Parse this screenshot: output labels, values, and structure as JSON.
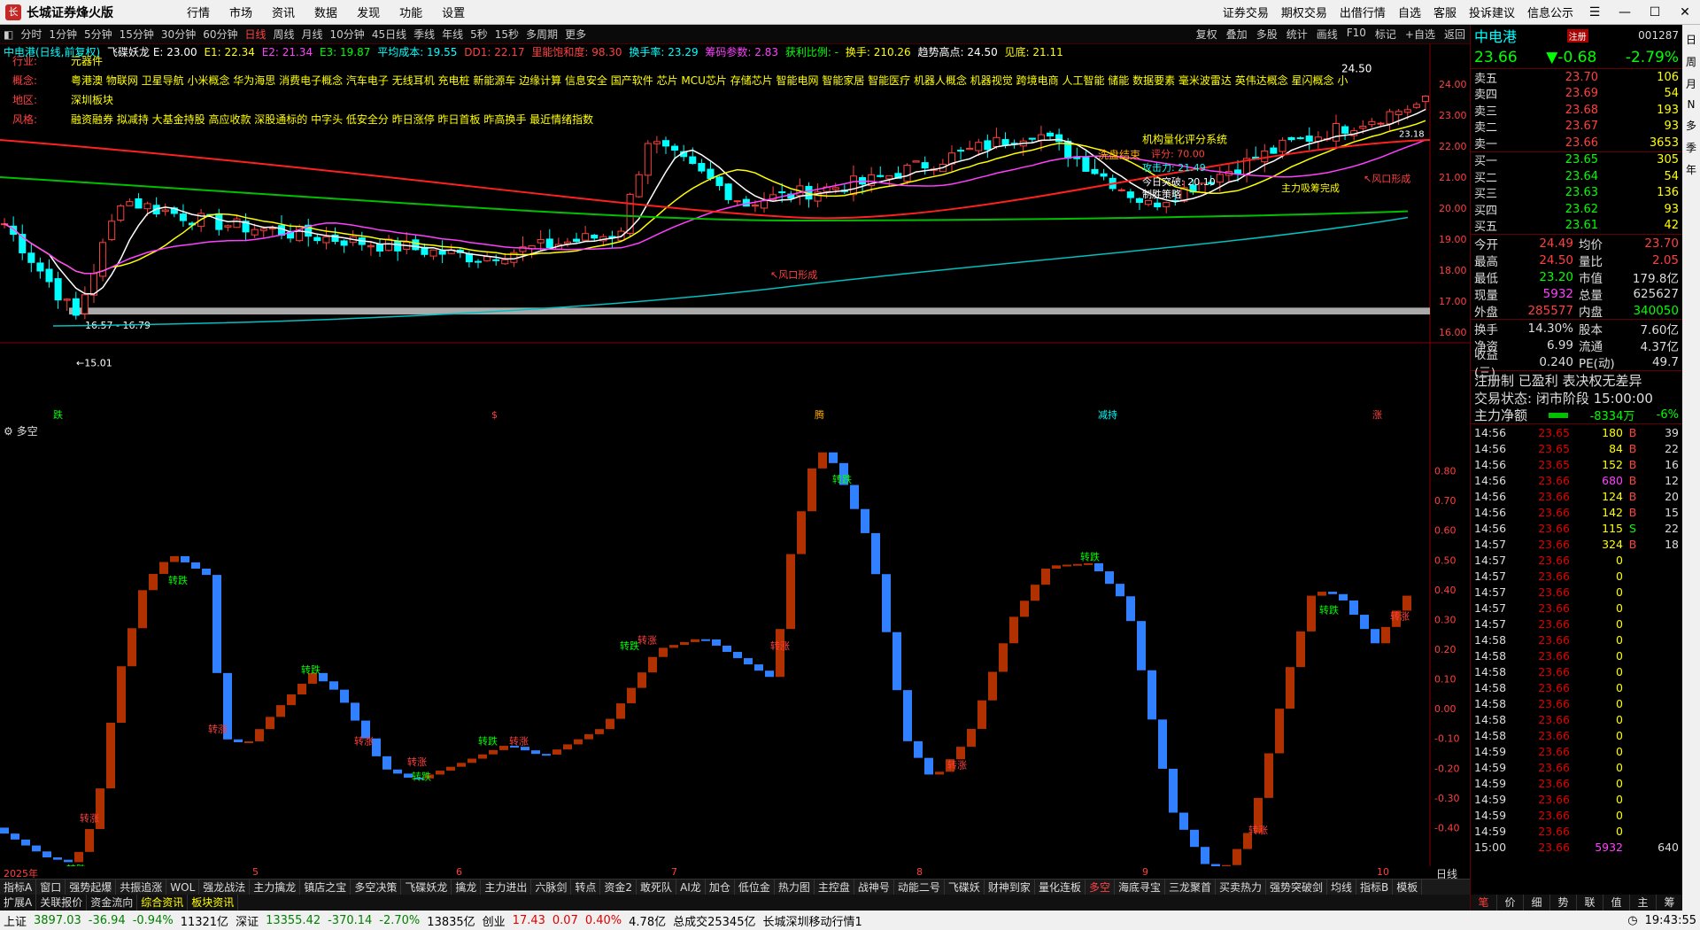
{
  "app": {
    "name": "长城证券烽火版",
    "menu": [
      "行情",
      "市场",
      "资讯",
      "数据",
      "发现",
      "功能",
      "设置"
    ],
    "right_menu": [
      "证券交易",
      "期权交易",
      "出借行情",
      "自选",
      "客服",
      "投诉建议",
      "信息公示"
    ]
  },
  "periods": [
    "分时",
    "1分钟",
    "5分钟",
    "15分钟",
    "30分钟",
    "60分钟",
    "日线",
    "周线",
    "月线",
    "10分钟",
    "45日线",
    "季线",
    "年线",
    "5秒",
    "15秒",
    "多周期",
    "更多"
  ],
  "active_period": "日线",
  "period_right": [
    "复权",
    "叠加",
    "多股",
    "统计",
    "画线",
    "F10",
    "标记",
    "+自选",
    "返回"
  ],
  "info_line": [
    {
      "t": "中电港(日线,前复权)",
      "c": "#00ffff"
    },
    {
      "t": "飞碟妖龙 E: 23.00",
      "c": "#ffffff"
    },
    {
      "t": "E1: 22.34",
      "c": "#ffff00"
    },
    {
      "t": "E2: 21.34",
      "c": "#ff40ff"
    },
    {
      "t": "E3: 19.87",
      "c": "#00ff00"
    },
    {
      "t": "平均成本: 19.55",
      "c": "#00ffff"
    },
    {
      "t": "DD1: 22.17",
      "c": "#ff4040"
    },
    {
      "t": "里能饱和度: 98.30",
      "c": "#ff4040"
    },
    {
      "t": "换手率: 23.29",
      "c": "#00ffff"
    },
    {
      "t": "筹码参数: 2.83",
      "c": "#ff40ff"
    },
    {
      "t": "获利比例: -",
      "c": "#00ff00"
    },
    {
      "t": "换手: 210.26",
      "c": "#ffff00"
    },
    {
      "t": "趋势高点: 24.50",
      "c": "#ffffff"
    },
    {
      "t": "见底: 21.11",
      "c": "#ffff00"
    }
  ],
  "tags": [
    {
      "k": "行业:",
      "v": "元器件"
    },
    {
      "k": "概念:",
      "v": "粤港澳 物联网 卫星导航 小米概念 华为海思 消费电子概念 汽车电子 无线耳机 充电桩 新能源车 边缘计算 信息安全 国产软件 芯片 MCU芯片 存储芯片 智能电网 智能家居 智能医疗 机器人概念 机器视觉 跨境电商 人工智能 储能 数据要素 毫米波雷达 英伟达概念 星闪概念 小"
    },
    {
      "k": "地区:",
      "v": "深圳板块"
    },
    {
      "k": "风格:",
      "v": "融资融券 拟减持 大基金持股 高应收款 深股通标的 中字头 低安全分 昨日涨停 昨日首板 昨高换手 最近情绪指数"
    }
  ],
  "price_axis": [
    "24.00",
    "23.00",
    "22.00",
    "21.00",
    "20.00",
    "19.00",
    "18.00",
    "17.00",
    "16.00"
  ],
  "annotations": {
    "support": "16.57 - 16.79",
    "low": "←15.01",
    "high": "24.50",
    "wind1": "↖风口形成",
    "wind2": "↖风口形成",
    "quant": "机构量化评分系统",
    "wash": "洗盘结束",
    "score": "评分: 70.00",
    "attack": "攻击力: 21.49",
    "main_done": "主力吸筹完成",
    "inst": "制胜策略",
    "trend_line": "今日突破: 20.10",
    "right_lbl": "23.18",
    "wash2": "洗盘动力"
  },
  "event_marks": [
    {
      "t": "跌",
      "c": "#00ff00"
    },
    {
      "t": "$",
      "c": "#ff4040"
    },
    {
      "t": "腾",
      "c": "#ffaa00"
    },
    {
      "t": "减持",
      "c": "#00ffff"
    },
    {
      "t": "涨",
      "c": "#ff4040"
    }
  ],
  "osc": {
    "title": "多空",
    "axis": [
      "0.80",
      "0.70",
      "0.60",
      "0.50",
      "0.40",
      "0.30",
      "0.20",
      "0.10",
      "0.00",
      "-0.10",
      "-0.20",
      "-0.30",
      "-0.40"
    ],
    "up_label": "转涨",
    "down_label": "转跌"
  },
  "date_axis": [
    "2025年",
    "5",
    "6",
    "7",
    "8",
    "9",
    "10"
  ],
  "date_axis_right": "日线",
  "ind_tabs": [
    "指标A",
    "窗口",
    "强势起爆",
    "共振追涨",
    "WOL",
    "强龙战法",
    "主力擒龙",
    "镇店之宝",
    "多空决策",
    "飞碟妖龙",
    "擒龙",
    "主力进出",
    "六脉剑",
    "转点",
    "资金2",
    "敢死队",
    "AI龙",
    "加仓",
    "低位金",
    "热力图",
    "主控盘",
    "战神号",
    "动能二号",
    "飞碟妖",
    "财神到家",
    "量化连板",
    "多空",
    "海底寻宝",
    "三龙聚首",
    "买卖热力",
    "强势突破剑",
    "均线",
    "指标B",
    "模板"
  ],
  "active_ind": "多空",
  "sub_tabs": [
    "扩展A",
    "关联报价",
    "资金流向",
    "综合资讯",
    "板块资讯"
  ],
  "right_panel": {
    "name": "中电港",
    "tag": "注册",
    "code": "001287",
    "price": "23.66",
    "change": "▼-0.68",
    "pct": "-2.79%",
    "asks": [
      {
        "l": "卖五",
        "p": "23.70",
        "q": "106"
      },
      {
        "l": "卖四",
        "p": "23.69",
        "q": "54"
      },
      {
        "l": "卖三",
        "p": "23.68",
        "q": "193"
      },
      {
        "l": "卖二",
        "p": "23.67",
        "q": "93"
      },
      {
        "l": "卖一",
        "p": "23.66",
        "q": "3653"
      }
    ],
    "bids": [
      {
        "l": "买一",
        "p": "23.65",
        "q": "305"
      },
      {
        "l": "买二",
        "p": "23.64",
        "q": "54"
      },
      {
        "l": "买三",
        "p": "23.63",
        "q": "136"
      },
      {
        "l": "买四",
        "p": "23.62",
        "q": "93"
      },
      {
        "l": "买五",
        "p": "23.61",
        "q": "42"
      }
    ],
    "stats": [
      {
        "a": "今开",
        "b": "24.49",
        "bc": "#ff4040",
        "c": "均价",
        "d": "23.70",
        "dc": "#ff4040"
      },
      {
        "a": "最高",
        "b": "24.50",
        "bc": "#ff4040",
        "c": "量比",
        "d": "2.05",
        "dc": "#ff4040"
      },
      {
        "a": "最低",
        "b": "23.20",
        "bc": "#00ff00",
        "c": "市值",
        "d": "179.8亿",
        "dc": "#ddd"
      },
      {
        "a": "现量",
        "b": "5932",
        "bc": "#ff40ff",
        "c": "总量",
        "d": "625627",
        "dc": "#ddd"
      },
      {
        "a": "外盘",
        "b": "285577",
        "bc": "#ff4040",
        "c": "内盘",
        "d": "340050",
        "dc": "#00ff00"
      }
    ],
    "stats2": [
      {
        "a": "换手",
        "b": "14.30%",
        "bc": "#ddd",
        "c": "股本",
        "d": "7.60亿",
        "dc": "#ddd"
      },
      {
        "a": "净资",
        "b": "6.99",
        "bc": "#ddd",
        "c": "流通",
        "d": "4.37亿",
        "dc": "#ddd"
      },
      {
        "a": "收益(三)",
        "b": "0.240",
        "bc": "#ddd",
        "c": "PE(动)",
        "d": "49.7",
        "dc": "#ddd"
      }
    ],
    "reg": "注册制 已盈利 表决权无差异",
    "state": "交易状态: 闭市阶段 15:00:00",
    "flow_label": "主力净额",
    "flow_val": "-8334万",
    "flow_pct": "-6%",
    "ticks": [
      {
        "t": "14:56",
        "p": "23.65",
        "v": "180",
        "s": "B",
        "n": "39"
      },
      {
        "t": "14:56",
        "p": "23.65",
        "v": "84",
        "s": "B",
        "n": "22"
      },
      {
        "t": "14:56",
        "p": "23.65",
        "v": "152",
        "s": "B",
        "n": "16"
      },
      {
        "t": "14:56",
        "p": "23.66",
        "v": "680",
        "s": "B",
        "n": "12"
      },
      {
        "t": "14:56",
        "p": "23.66",
        "v": "124",
        "s": "B",
        "n": "20"
      },
      {
        "t": "14:56",
        "p": "23.66",
        "v": "142",
        "s": "B",
        "n": "15"
      },
      {
        "t": "14:56",
        "p": "23.66",
        "v": "115",
        "s": "S",
        "n": "22"
      },
      {
        "t": "14:57",
        "p": "23.66",
        "v": "324",
        "s": "B",
        "n": "18"
      },
      {
        "t": "14:57",
        "p": "23.66",
        "v": "0",
        "s": "",
        "n": ""
      },
      {
        "t": "14:57",
        "p": "23.66",
        "v": "0",
        "s": "",
        "n": ""
      },
      {
        "t": "14:57",
        "p": "23.66",
        "v": "0",
        "s": "",
        "n": ""
      },
      {
        "t": "14:57",
        "p": "23.66",
        "v": "0",
        "s": "",
        "n": ""
      },
      {
        "t": "14:57",
        "p": "23.66",
        "v": "0",
        "s": "",
        "n": ""
      },
      {
        "t": "14:58",
        "p": "23.66",
        "v": "0",
        "s": "",
        "n": ""
      },
      {
        "t": "14:58",
        "p": "23.66",
        "v": "0",
        "s": "",
        "n": ""
      },
      {
        "t": "14:58",
        "p": "23.66",
        "v": "0",
        "s": "",
        "n": ""
      },
      {
        "t": "14:58",
        "p": "23.66",
        "v": "0",
        "s": "",
        "n": ""
      },
      {
        "t": "14:58",
        "p": "23.66",
        "v": "0",
        "s": "",
        "n": ""
      },
      {
        "t": "14:58",
        "p": "23.66",
        "v": "0",
        "s": "",
        "n": ""
      },
      {
        "t": "14:58",
        "p": "23.66",
        "v": "0",
        "s": "",
        "n": ""
      },
      {
        "t": "14:59",
        "p": "23.66",
        "v": "0",
        "s": "",
        "n": ""
      },
      {
        "t": "14:59",
        "p": "23.66",
        "v": "0",
        "s": "",
        "n": ""
      },
      {
        "t": "14:59",
        "p": "23.66",
        "v": "0",
        "s": "",
        "n": ""
      },
      {
        "t": "14:59",
        "p": "23.66",
        "v": "0",
        "s": "",
        "n": ""
      },
      {
        "t": "14:59",
        "p": "23.66",
        "v": "0",
        "s": "",
        "n": ""
      },
      {
        "t": "14:59",
        "p": "23.66",
        "v": "0",
        "s": "",
        "n": ""
      },
      {
        "t": "15:00",
        "p": "23.66",
        "v": "5932",
        "s": "",
        "n": "640"
      }
    ],
    "foot": [
      "笔",
      "价",
      "细",
      "势",
      "联",
      "值",
      "主",
      "筹"
    ]
  },
  "sidebar": [
    "日",
    "周",
    "月",
    "N",
    "多",
    "季",
    "年"
  ],
  "status": {
    "sh_label": "上证",
    "sh": "3897.03",
    "sh_chg": "-36.94",
    "sh_pct": "-0.94%",
    "sh_amt": "11321亿",
    "sz_label": "深证",
    "sz": "13355.42",
    "sz_chg": "-370.14",
    "sz_pct": "-2.70%",
    "sz_amt": "13835亿",
    "cy_label": "创业",
    "cy": "17.43",
    "cy_chg": "0.07",
    "cy_pct": "0.40%",
    "cy_amt": "4.78亿",
    "total": "总成交25345亿",
    "broker": "长城深圳移动行情1",
    "time": "19:43:55"
  },
  "chart_data": {
    "type": "candlestick",
    "title": "中电港(日线,前复权)",
    "x": [
      "2025年",
      "5",
      "6",
      "7",
      "8",
      "9",
      "10"
    ],
    "ylim": [
      15.0,
      25.0
    ],
    "high": 24.5,
    "low": 15.01,
    "close_last": 23.66,
    "oscillator": {
      "name": "多空",
      "ylim": [
        -0.5,
        0.9
      ]
    }
  }
}
